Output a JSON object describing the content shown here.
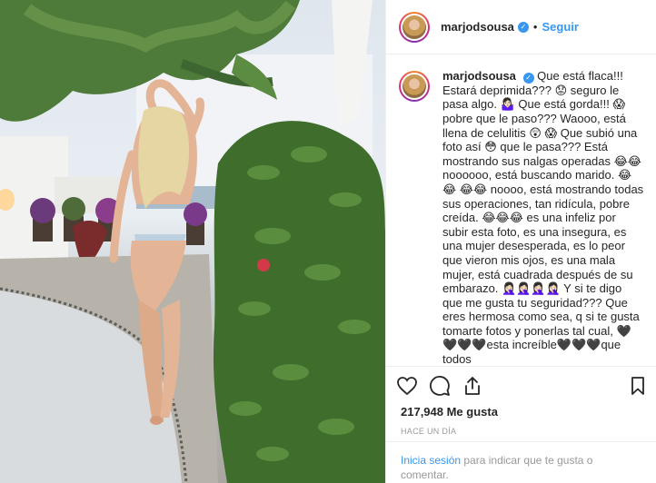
{
  "post": {
    "username": "marjodsousa",
    "follow_label": "Seguir",
    "separator": "•"
  },
  "caption": {
    "username": "marjodsousa",
    "text": "Que está flaca!!! Estará deprimida??? 😟 seguro le pasa algo. 🤷🏻‍♀️ Que está gorda!!! 😱 pobre que le paso??? Waooo, está llena de celulitis 😲 😱 Que subió una foto así 😳 que le pasa??? Está mostrando sus nalgas operadas 😂😂 noooooo, está buscando marido. 😂😂 😂😂 noooo, está mostrando todas sus operaciones, tan ridícula, pobre creída. 😂😂😂 es una infeliz por subir esta foto, es una insegura, es una mujer desesperada, es lo peor que vieron mis ojos, es una mala mujer, está cuadrada después de su embarazo. 🤦🏻‍♀️🤦🏻‍♀️🤦🏻‍♀️🤦🏻‍♀️ Y si te digo que me gusta tu seguridad??? Que eres hermosa como sea, q si te gusta tomarte fotos y ponerlas tal cual, 🖤🖤🖤🖤esta increíble🖤🖤🖤que todos"
  },
  "actions": {
    "likes": "217,948 Me gusta",
    "time_ago": "HACE UN DÍA",
    "icons": [
      "heart-icon",
      "comment-icon",
      "share-icon",
      "bookmark-icon"
    ]
  },
  "login": {
    "link_label": "Inicia sesión",
    "rest_text": " para indicar que te gusta o comentar."
  },
  "colors": {
    "accent": "#3897f0",
    "text": "#262626",
    "muted": "#999999",
    "border": "#efefef"
  }
}
